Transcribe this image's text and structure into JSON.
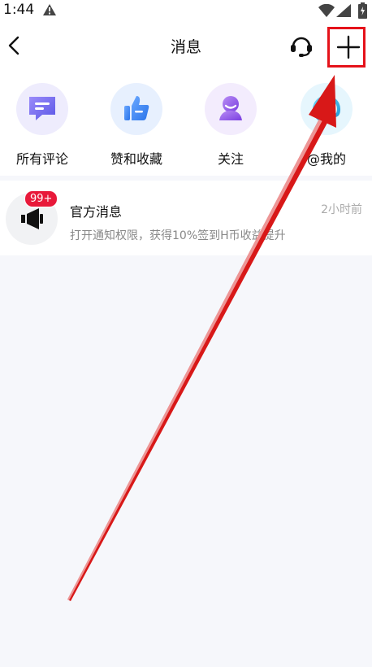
{
  "status_bar": {
    "time": "1:44",
    "icons": [
      "warning-icon",
      "wifi-icon",
      "signal-icon",
      "battery-icon"
    ]
  },
  "header": {
    "title": "消息",
    "back_icon": "chevron-left-icon",
    "support_icon": "headset-icon",
    "add_icon": "plus-icon"
  },
  "categories": [
    {
      "label": "所有评论",
      "icon": "comment-icon",
      "color": "#7b6ff2"
    },
    {
      "label": "赞和收藏",
      "icon": "thumbs-up-icon",
      "color": "#3d8bf5"
    },
    {
      "label": "关注",
      "icon": "follow-icon",
      "color": "#9b5ce8"
    },
    {
      "label": "@我的",
      "icon": "at-icon",
      "color": "#36b7e8"
    }
  ],
  "messages": [
    {
      "title": "官方消息",
      "time": "2小时前",
      "preview": "打开通知权限，获得10%签到H币收益提升",
      "badge": "99+",
      "icon": "megaphone-icon"
    }
  ],
  "annotation": {
    "highlight_color": "#e5121a"
  }
}
